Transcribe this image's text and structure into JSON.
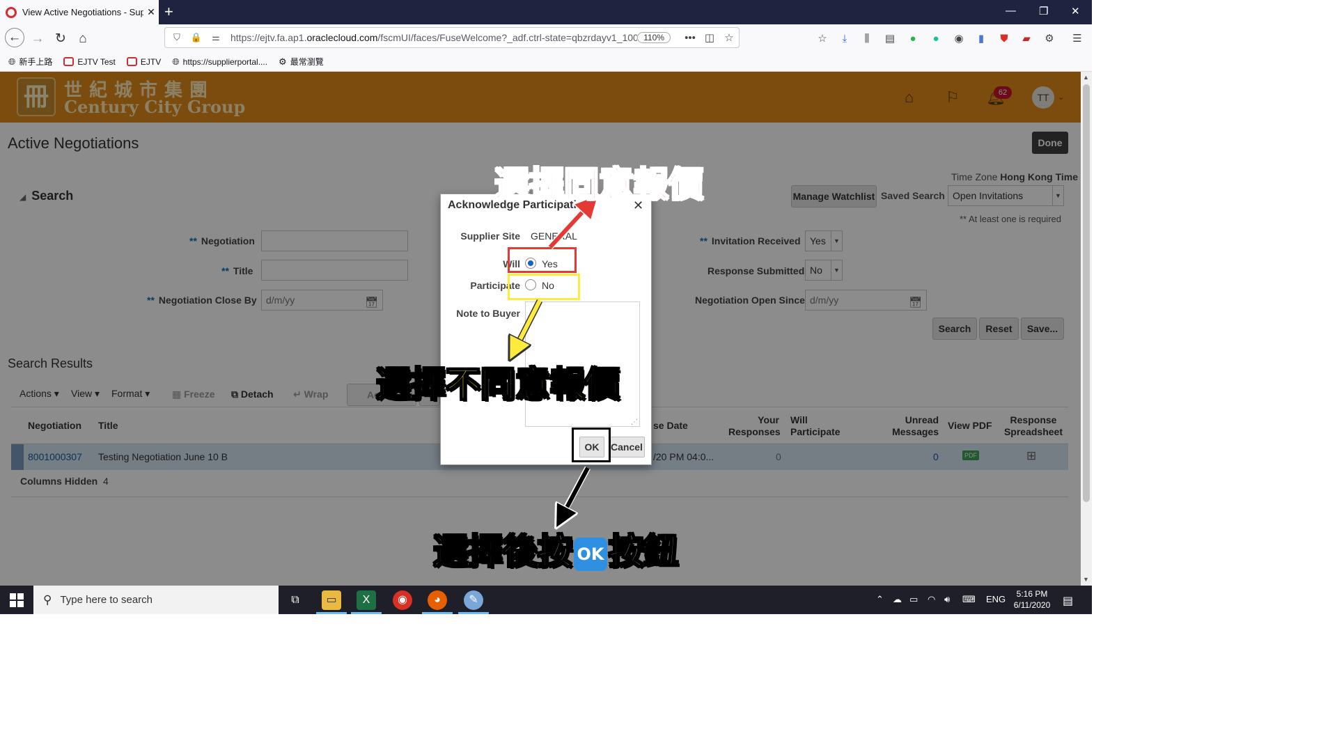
{
  "browser": {
    "tab_title": "View Active Negotiations - Sup",
    "tab_close": "✕",
    "new_tab": "+",
    "url_prefix": "https://ejtv.fa.ap1.",
    "url_domain": "oraclecloud.com",
    "url_suffix": "/fscmUI/faces/FuseWelcome?_adf.ctrl-state=qbzrdayv1_100",
    "zoom": "110%",
    "bookmarks": [
      "新手上路",
      "EJTV Test",
      "EJTV",
      "https://supplierportal....",
      "最常瀏覽"
    ]
  },
  "header": {
    "logo_cn": "世紀城市集團",
    "logo_en": "Century City Group",
    "notification_count": "62",
    "avatar_initials": "TT"
  },
  "page": {
    "title": "Active Negotiations",
    "done_label": "Done",
    "search_section": "Search",
    "timezone_label": "Time Zone",
    "timezone_value": "Hong Kong Time",
    "manage_watchlist": "Manage Watchlist",
    "saved_search_label": "Saved Search",
    "saved_search_value": "Open Invitations",
    "required_note": "** At least one is required",
    "fields": {
      "negotiation": "Negotiation",
      "title": "Title",
      "negotiation_close_by": "Negotiation Close By",
      "close_by_placeholder": "d/m/yy",
      "invitation_received": "Invitation Received",
      "invitation_received_value": "Yes",
      "response_submitted": "Response Submitted",
      "response_submitted_value": "No",
      "negotiation_open_since": "Negotiation Open Since",
      "open_since_placeholder": "d/m/yy",
      "req_mark": "**"
    },
    "buttons": {
      "search": "Search",
      "reset": "Reset",
      "save": "Save..."
    },
    "results_section": "Search Results",
    "toolbar": {
      "actions": "Actions",
      "view": "View",
      "format": "Format",
      "freeze": "Freeze",
      "detach": "Detach",
      "wrap": "Wrap",
      "accept": "Accep"
    },
    "table": {
      "headers": {
        "negotiation": "Negotiation",
        "title": "Title",
        "close_date": "se Date",
        "your_responses_1": "Your",
        "your_responses_2": "Responses",
        "will_participate_1": "Will",
        "will_participate_2": "Participate",
        "unread_1": "Unread",
        "unread_2": "Messages",
        "view_pdf": "View PDF",
        "resp_sheet_1": "Response",
        "resp_sheet_2": "Spreadsheet"
      },
      "row": {
        "negotiation": "8001000307",
        "title": "Testing Negotiation June 10 B",
        "close_date": "/20 PM 04:0...",
        "your_responses": "0",
        "unread_messages": "0",
        "pdf_label": "PDF"
      },
      "columns_hidden_label": "Columns Hidden",
      "columns_hidden_count": "4"
    }
  },
  "dialog": {
    "title": "Acknowledge Participation",
    "close": "✕",
    "supplier_site_label": "Supplier Site",
    "supplier_site_value": "GENERAL",
    "will_label": "Will",
    "participate_label": "Participate",
    "yes_label": "Yes",
    "no_label": "No",
    "yes_selected": true,
    "note_label": "Note to Buyer",
    "ok_label": "OK",
    "cancel_label": "Cancel"
  },
  "annotations": {
    "agree": "選擇同意報價",
    "disagree": "選擇不同意報價",
    "press_ok_prefix": "選擇後按",
    "press_ok_emoji": "OK",
    "press_ok_suffix": "按鈕",
    "colors": {
      "red": "#e53935",
      "yellow": "#ffeb3b",
      "black": "#000000"
    }
  },
  "taskbar": {
    "search_placeholder": "Type here to search",
    "lang": "ENG",
    "time": "5:16 PM",
    "date": "6/11/2020"
  }
}
